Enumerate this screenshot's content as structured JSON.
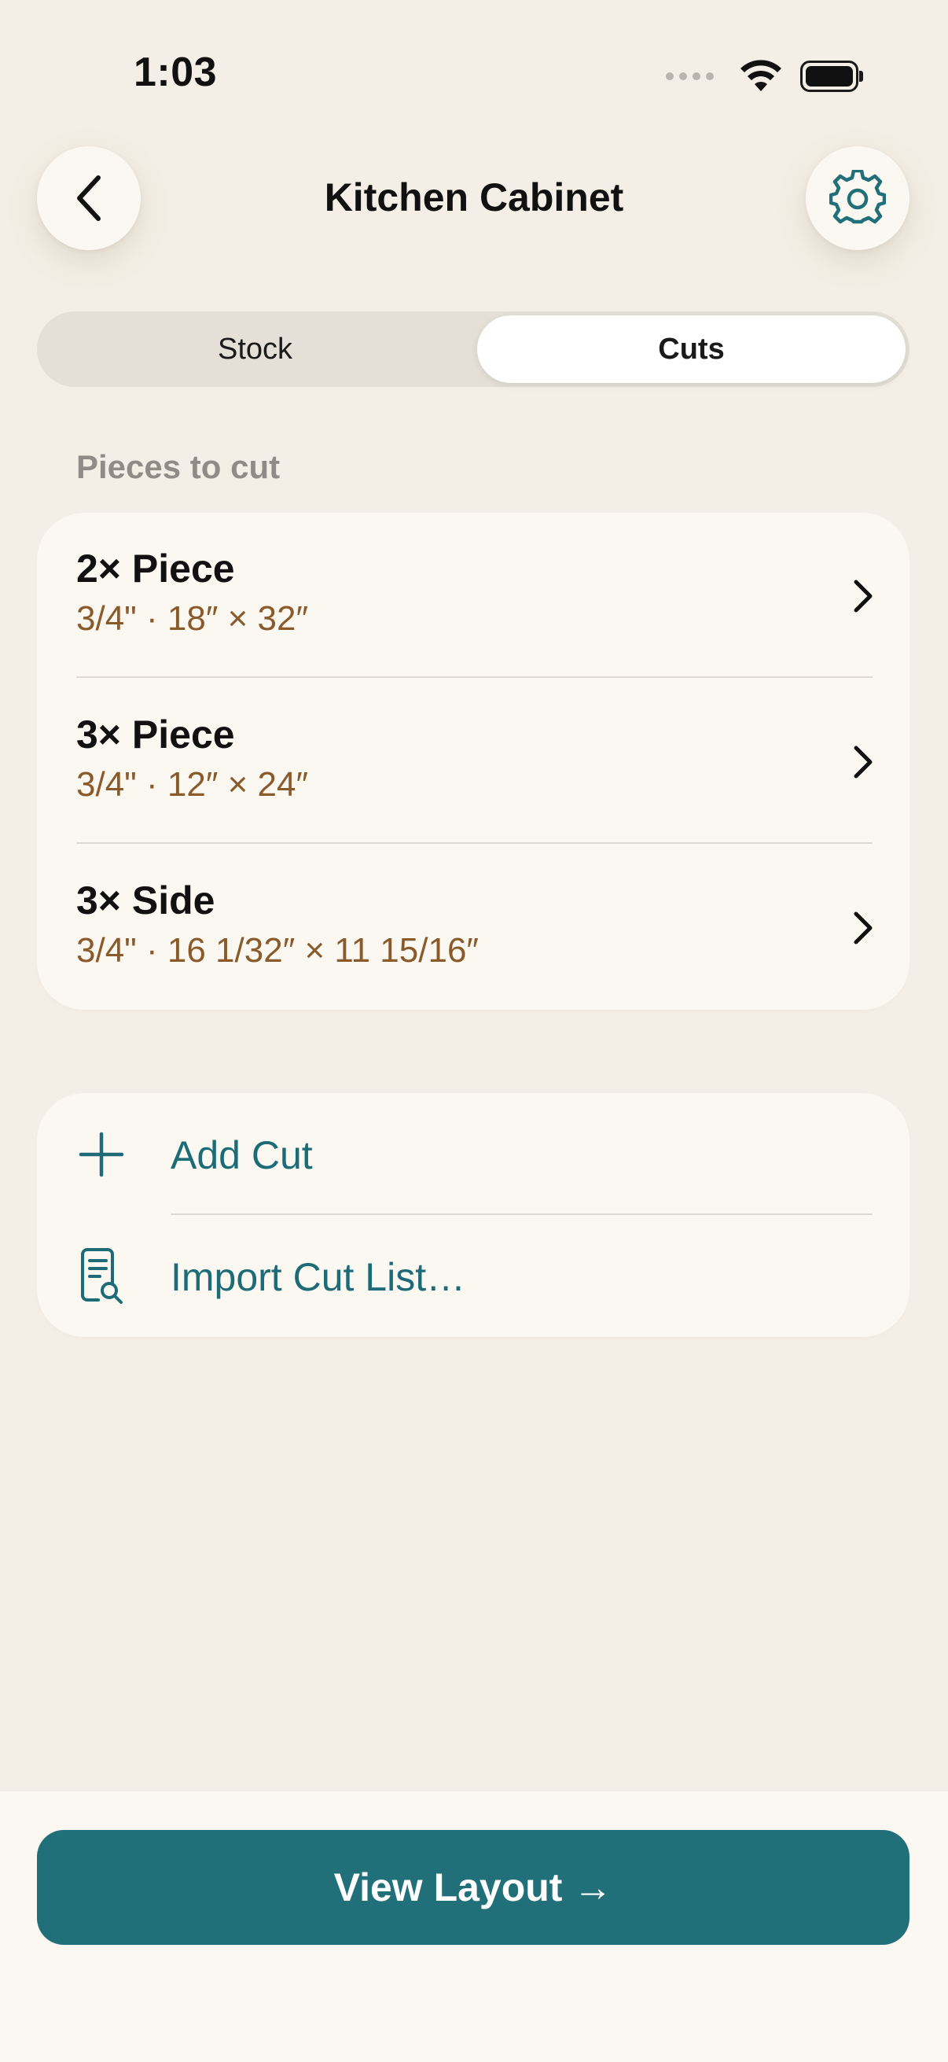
{
  "status_bar": {
    "time": "1:03"
  },
  "header": {
    "title": "Kitchen Cabinet",
    "back_icon": "chevron-left-icon",
    "settings_icon": "gear-icon"
  },
  "segmented_control": {
    "segments": [
      "Stock",
      "Cuts"
    ],
    "selected": "Cuts"
  },
  "section": {
    "label": "Pieces to cut"
  },
  "cuts": [
    {
      "title": "2× Piece",
      "detail": "3/4\" · 18″ × 32″"
    },
    {
      "title": "3× Piece",
      "detail": "3/4\" · 12″ × 24″"
    },
    {
      "title": "3× Side",
      "detail": "3/4\" · 16 1/32″ × 11 15/16″"
    }
  ],
  "actions": [
    {
      "label": "Add Cut",
      "icon": "plus-icon"
    },
    {
      "label": "Import Cut List…",
      "icon": "document-search-icon"
    }
  ],
  "footer": {
    "primary_button": "View Layout →"
  },
  "colors": {
    "background": "#f4efe6",
    "card": "#fbf8f2",
    "accent": "#216f79",
    "link": "#1e6b78",
    "detail_text": "#8b5a2b",
    "section_label": "#8f8c88"
  }
}
